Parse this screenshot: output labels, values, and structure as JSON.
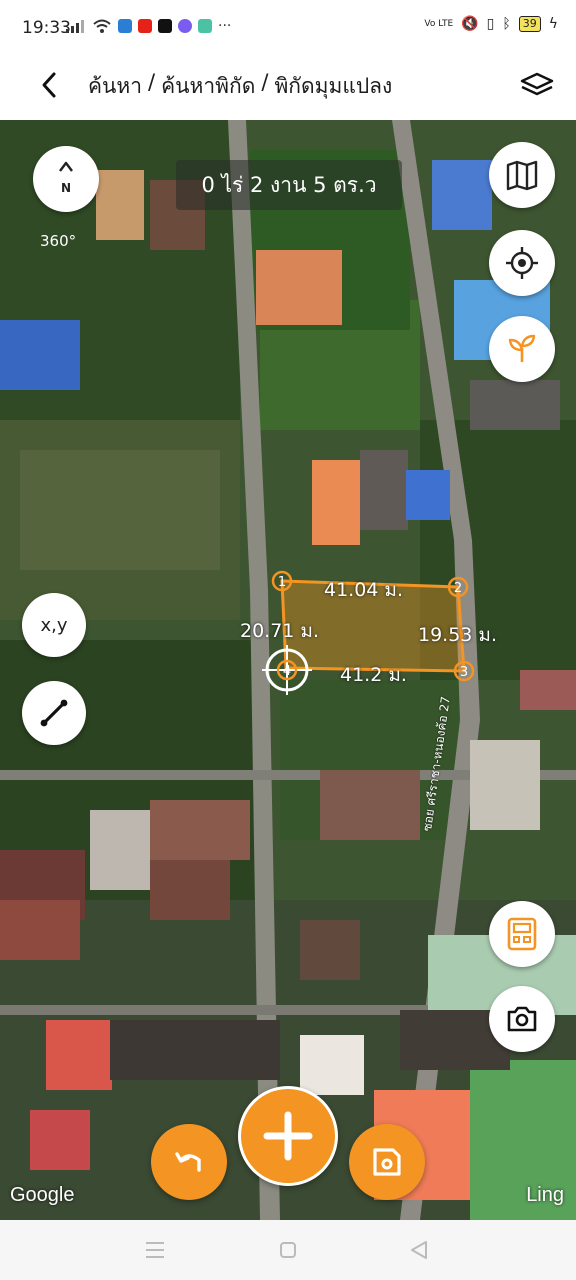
{
  "status_bar": {
    "time": "19:33",
    "battery": "39",
    "network": "Vo LTE"
  },
  "header": {
    "breadcrumb": [
      "ค้นหา",
      "ค้นหาพิกัด",
      "พิกัดมุมแปลง"
    ],
    "separator": "/"
  },
  "map": {
    "area_label": "0 ไร่ 2 งาน 5 ตร.ว",
    "compass_label": "360°",
    "compass_letter": "N",
    "xy_button_label": "x,y",
    "road_label": "ซอย ศรีราชา-หนองค้อ 27",
    "google_attribution": "Google",
    "ling_attribution": "Ling",
    "plot": {
      "color": "#f39423",
      "corners": [
        "1",
        "2",
        "3",
        "4"
      ],
      "edges": {
        "top": "41.04 ม.",
        "bottom": "41.2 ม.",
        "left": "20.71 ม.",
        "right": "19.53 ม."
      }
    }
  },
  "buttons": {
    "map_type": "map-icon",
    "locate": "crosshair-icon",
    "plant": "sprout-icon",
    "calculator": "calculator-icon",
    "camera": "camera-icon",
    "undo": "undo-icon",
    "add": "plus-icon",
    "save": "save-icon"
  },
  "colors": {
    "accent": "#f39423",
    "header_bg": "#ffffff"
  }
}
